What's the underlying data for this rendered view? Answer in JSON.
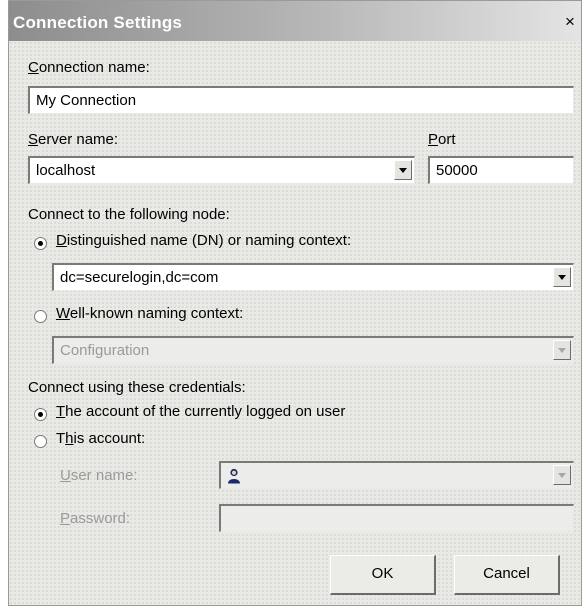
{
  "window": {
    "title": "Connection Settings",
    "close_glyph": "×"
  },
  "connection_name": {
    "label_accel": "C",
    "label_rest": "onnection name:",
    "value": "My Connection"
  },
  "server_name": {
    "label_accel": "S",
    "label_rest": "erver name:",
    "value": "localhost"
  },
  "port": {
    "label_accel": "P",
    "label_rest": "ort",
    "value": "50000"
  },
  "node_section": {
    "heading": "Connect to the following node:",
    "dn_option": {
      "label_accel": "D",
      "label_rest": "istinguished name (DN) or naming context:",
      "selected": true,
      "value": "dc=securelogin,dc=com"
    },
    "wk_option": {
      "label_accel": "W",
      "label_rest": "ell-known naming context:",
      "selected": false,
      "value": "Configuration"
    }
  },
  "credentials_section": {
    "heading": "Connect using these credentials:",
    "current_user_option": {
      "label_accel": "T",
      "label_rest": "he account of the currently logged on user",
      "selected": true
    },
    "this_account_option": {
      "label_pre": "T",
      "label_accel": "h",
      "label_rest": "is account:",
      "selected": false
    },
    "user_name": {
      "label_accel": "U",
      "label_rest": "ser name:",
      "value": ""
    },
    "password": {
      "label_accel": "P",
      "label_rest": "assword:",
      "value": ""
    }
  },
  "buttons": {
    "ok": "OK",
    "cancel": "Cancel"
  }
}
